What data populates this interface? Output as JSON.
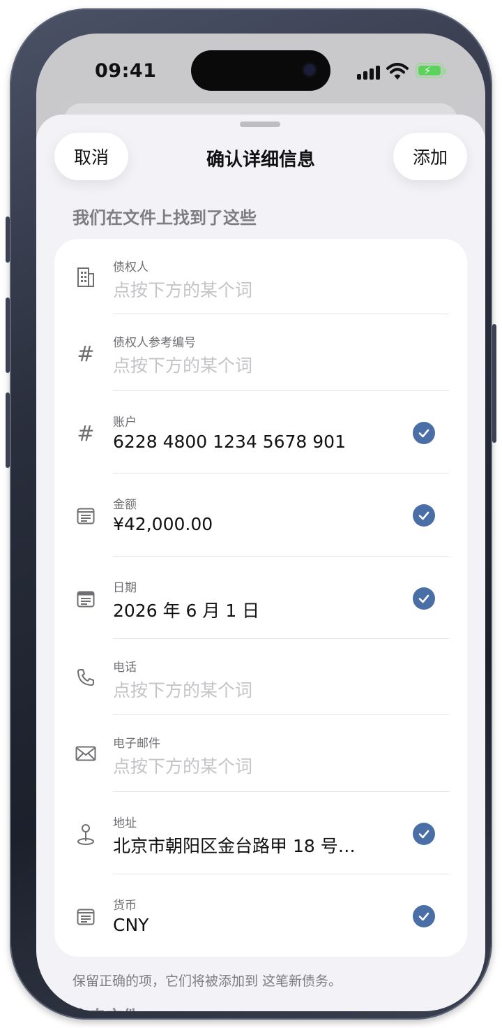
{
  "status_bar": {
    "time": "09:41"
  },
  "sheet": {
    "title": "确认详细信息",
    "cancel_label": "取消",
    "add_label": "添加",
    "section_header": "我们在文件上找到了这些",
    "footnote": "保留正确的项，它们将被添加到 这笔新债务。",
    "next_section_header": "来自文件"
  },
  "fields": [
    {
      "label": "债权人",
      "value": "点按下方的某个词",
      "placeholder": true,
      "checked": false,
      "icon": "building-icon"
    },
    {
      "label": "债权人参考编号",
      "value": "点按下方的某个词",
      "placeholder": true,
      "checked": false,
      "icon": "hash-icon"
    },
    {
      "label": "账户",
      "value": "6228 4800 1234 5678 901",
      "placeholder": false,
      "checked": true,
      "icon": "hash-icon"
    },
    {
      "label": "金额",
      "value": "¥42,000.00",
      "placeholder": false,
      "checked": true,
      "icon": "document-icon"
    },
    {
      "label": "日期",
      "value": "2026 年 6 月 1 日",
      "placeholder": false,
      "checked": true,
      "icon": "calendar-icon"
    },
    {
      "label": "电话",
      "value": "点按下方的某个词",
      "placeholder": true,
      "checked": false,
      "icon": "phone-icon"
    },
    {
      "label": "电子邮件",
      "value": "点按下方的某个词",
      "placeholder": true,
      "checked": false,
      "icon": "envelope-icon"
    },
    {
      "label": "地址",
      "value": "北京市朝阳区金台路甲 18 号…",
      "placeholder": false,
      "checked": true,
      "icon": "map-pin-icon"
    },
    {
      "label": "货币",
      "value": "CNY",
      "placeholder": false,
      "checked": true,
      "icon": "document-icon"
    }
  ],
  "colors": {
    "accent": "#4a6ea6",
    "sheet_bg": "#f2f2f7",
    "placeholder": "#c4c4c8"
  }
}
